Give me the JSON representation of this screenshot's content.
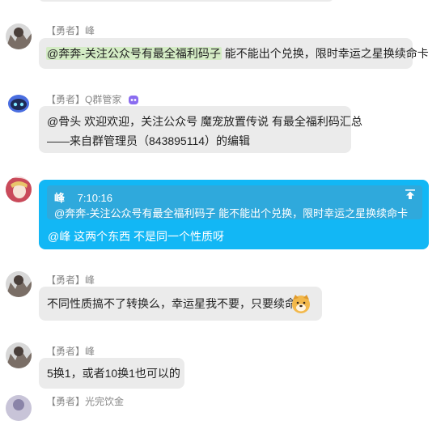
{
  "messages": [
    {
      "role": "【勇者】",
      "name": "峰",
      "mention": "@奔奔-关注公众号有最全福利码子",
      "text": "能不能出个兑换，限时幸运之星换续命卡"
    },
    {
      "role": "【勇者】",
      "name": "Q群管家",
      "line1": "@骨头 欢迎欢迎，关注公众号 魔宠放置传说 有最全福利码汇总",
      "line2": "——来自群管理员（843895114）的编辑"
    },
    {
      "quote_name": "峰",
      "quote_time": "7:10:16",
      "quote_text": "@奔奔-关注公众号有最全福利码子 能不能出个兑换，限时幸运之星换续命卡",
      "text": "@峰 这两个东西 不是同一个性质呀"
    },
    {
      "role": "【勇者】",
      "name": "峰",
      "text": "不同性质搞不了转换么，幸运星我不要，只要续命卡"
    },
    {
      "role": "【勇者】",
      "name": "峰",
      "text": "5换1，或者10换1也可以的"
    },
    {
      "role": "【勇者】",
      "name": "光完饮金"
    }
  ],
  "colors": {
    "bubble": "#ebebeb",
    "self_bubble": "#12b7f5",
    "mention_highlight": "#d4ecc5"
  }
}
